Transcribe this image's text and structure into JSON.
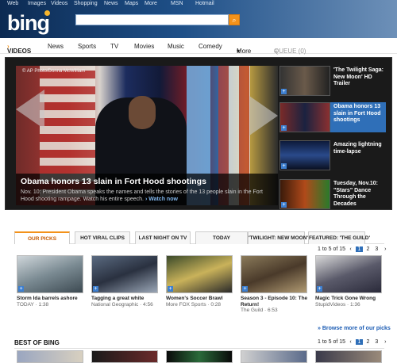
{
  "topnav": [
    "Web",
    "Images",
    "Videos",
    "Shopping",
    "News",
    "Maps",
    "More",
    "MSN",
    "Hotmail"
  ],
  "logo": "bing",
  "subnav": {
    "videos": "VIDEOS",
    "videos_arrow": "›",
    "items": [
      "News",
      "Sports",
      "TV",
      "Movies",
      "Music",
      "Comedy",
      "More"
    ],
    "more_arrow": "▾",
    "queue": "QUEUE (0)"
  },
  "hero": {
    "credit": "© AP Photo/Donna McWilliam",
    "title": "Obama honors 13 slain in Fort Hood shootings",
    "desc": "Nov. 10: President Obama speaks the names and tells the stories of the 13 people slain in the Fort Hood shooting rampage. Watch his entire speech.",
    "watch": "›  Watch now"
  },
  "side": [
    {
      "text": "'The Twilight Saga: New Moon' HD Trailer"
    },
    {
      "text": "Obama honors 13 slain in Fort Hood shootings"
    },
    {
      "text": "Amazing lightning time-lapse"
    },
    {
      "text": "Tuesday, Nov.10: \"Stars\" Dance Through the Decades"
    }
  ],
  "tabs": [
    "OUR PICKS",
    "HOT VIRAL CLIPS",
    "LAST NIGHT ON TV",
    "TODAY",
    "'TWILIGHT: NEW MOON'",
    "FEATURED: 'THE GUILD'"
  ],
  "pager": {
    "range": "1 to 5 of 15",
    "prev": "‹",
    "pages": [
      "1",
      "2",
      "3"
    ],
    "next": "›"
  },
  "cards": [
    {
      "title": "Storm Ida barrels ashore",
      "meta": "TODAY · 1:38"
    },
    {
      "title": "Tagging a great white",
      "meta": "National Geographic · 4:56"
    },
    {
      "title": "Women's Soccer Brawl",
      "meta": "More FOX Sports · 0:28"
    },
    {
      "title": "Season 3 - Episode 10: The Return!",
      "meta": "The Guild · 6:53"
    },
    {
      "title": "Magic Trick Gone Wrong",
      "meta": "StupidVideos · 1:36"
    }
  ],
  "more_link": "» Browse more of our picks",
  "best": "BEST OF BING",
  "pager2": {
    "range": "1 to 5 of 15",
    "prev": "‹",
    "pages": [
      "1",
      "2",
      "3"
    ],
    "next": "›"
  }
}
